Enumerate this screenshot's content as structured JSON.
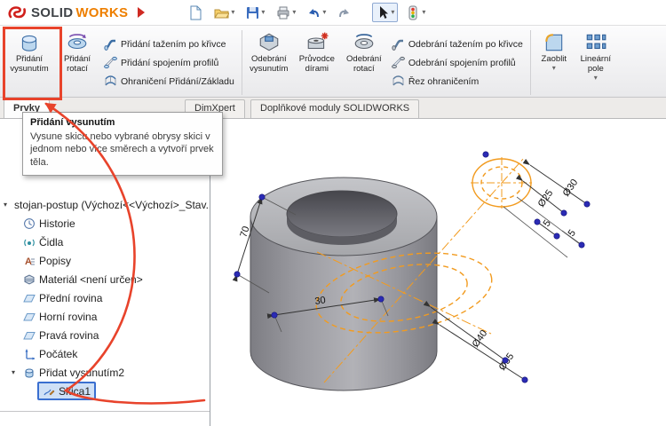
{
  "colors": {
    "annotation_red": "#e8432b",
    "sketch_orange": "#f29b1f",
    "selection_blue": "#3a6fd0",
    "brand_orange": "#ee7f00"
  },
  "titlebar": {
    "brand_solid": "SOLID",
    "brand_works": "WORKS",
    "icons": [
      "dassault-logo",
      "collapse-arrow",
      "new-document",
      "open",
      "save",
      "print",
      "undo",
      "redo",
      "select-cursor",
      "rebuild-traffic-light"
    ]
  },
  "ribbon": {
    "big": [
      "Přidání vysunutím",
      "Přidání rotací",
      "Odebrání vysunutím",
      "Průvodce dírami",
      "Odebrání rotací",
      "Zaoblit",
      "Lineární pole"
    ],
    "small": [
      "Přidání tažením po křivce",
      "Přidání spojením profilů",
      "Ohraničení Přidání/Základu",
      "Odebrání tažením po křivce",
      "Odebrání spojením profilů",
      "Řez ohraničením"
    ]
  },
  "tabs": [
    "Prvky",
    "DimXpert",
    "Doplňkové moduly SOLIDWORKS"
  ],
  "tooltip": {
    "title": "Přidání vysunutím",
    "body": "Vysune skicu nebo vybrané obrysy skici v jednom nebo více směrech a vytvoří prvek těla."
  },
  "tree": {
    "root": "stojan-postup (Výchozí<<Výchozí>_Stav...",
    "items": [
      {
        "label": "Historie",
        "icon": "history-icon"
      },
      {
        "label": "Čidla",
        "icon": "sensors-icon"
      },
      {
        "label": "Popisy",
        "icon": "annotations-icon"
      },
      {
        "label": "Materiál <není určen>",
        "icon": "material-icon"
      },
      {
        "label": "Přední rovina",
        "icon": "plane-icon"
      },
      {
        "label": "Horní rovina",
        "icon": "plane-icon"
      },
      {
        "label": "Pravá rovina",
        "icon": "plane-icon"
      },
      {
        "label": "Počátek",
        "icon": "origin-icon"
      },
      {
        "label": "Přidat vysunutím2",
        "icon": "boss-extrude-icon"
      },
      {
        "label": "Skica1",
        "icon": "sketch-icon",
        "selected": true
      }
    ]
  },
  "viewport": {
    "dims": {
      "height": "70",
      "width": "30",
      "d40": "Ø40",
      "d55": "Ø55",
      "d25": "Ø25",
      "d30": "Ø30",
      "g5a": "5",
      "g5b": "5"
    }
  }
}
